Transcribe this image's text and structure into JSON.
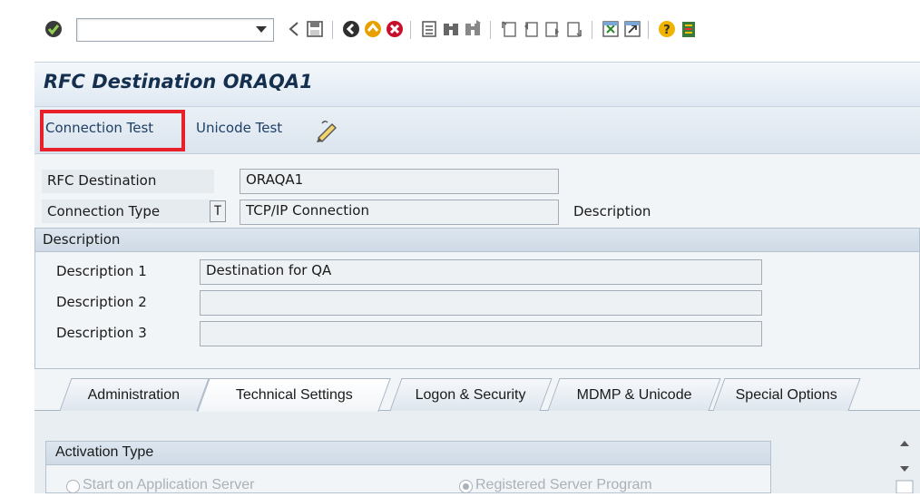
{
  "toolbar": {
    "command_field_value": "",
    "icons": [
      "enter-icon",
      "back-icon",
      "save-icon",
      "back-green-icon",
      "exit-icon",
      "cancel-icon",
      "print-icon",
      "find-icon",
      "find-next-icon",
      "first-page-icon",
      "prev-page-icon",
      "next-page-icon",
      "last-page-icon",
      "create-session-icon",
      "shortcut-icon",
      "help-icon",
      "layout-icon"
    ]
  },
  "title": "RFC Destination ORAQA1",
  "app_toolbar": {
    "connection_test": "Connection Test",
    "unicode_test": "Unicode Test"
  },
  "form": {
    "rfc_destination_label": "RFC Destination",
    "rfc_destination_value": "ORAQA1",
    "connection_type_label": "Connection Type",
    "connection_type_code": "T",
    "connection_type_value": "TCP/IP Connection",
    "connection_type_desc": "Description"
  },
  "description_group": {
    "title": "Description",
    "rows": [
      {
        "label": "Description 1",
        "value": "Destination for QA"
      },
      {
        "label": "Description 2",
        "value": ""
      },
      {
        "label": "Description 3",
        "value": ""
      }
    ]
  },
  "tabs": [
    {
      "label": "Administration"
    },
    {
      "label": "Technical Settings",
      "active": true
    },
    {
      "label": "Logon & Security"
    },
    {
      "label": "MDMP & Unicode"
    },
    {
      "label": "Special Options"
    }
  ],
  "activation": {
    "title": "Activation Type",
    "option1": "Start on Application Server",
    "option2": "Registered Server Program",
    "selected": "Registered Server Program"
  },
  "colors": {
    "highlight": "#e8202a",
    "title_text": "#15304f",
    "link_text": "#1e3f66"
  }
}
